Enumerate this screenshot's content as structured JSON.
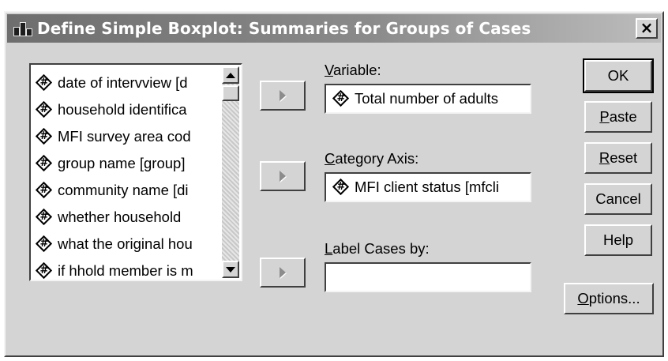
{
  "window": {
    "title": "Define Simple Boxplot: Summaries for Groups of Cases",
    "close_label": "×"
  },
  "variable_list": {
    "items": [
      {
        "label": "date of intervview [d",
        "icon": "numeric-variable-icon"
      },
      {
        "label": "household identifica",
        "icon": "numeric-variable-icon"
      },
      {
        "label": "MFI survey area cod",
        "icon": "numeric-variable-icon"
      },
      {
        "label": "group name [group]",
        "icon": "numeric-variable-icon"
      },
      {
        "label": "community name [di",
        "icon": "numeric-variable-icon"
      },
      {
        "label": "whether household",
        "icon": "numeric-variable-icon"
      },
      {
        "label": "what the original hou",
        "icon": "numeric-variable-icon"
      },
      {
        "label": "if hhold member is m",
        "icon": "numeric-variable-icon"
      }
    ]
  },
  "fields": {
    "variable": {
      "label_mnemonic": "V",
      "label_rest": "ariable:",
      "value": "Total number of adults"
    },
    "category_axis": {
      "label_mnemonic": "C",
      "label_rest": "ategory Axis:",
      "value": "MFI client status [mfcli"
    },
    "label_cases": {
      "label_mnemonic": "L",
      "label_rest": "abel Cases by:",
      "value": ""
    }
  },
  "buttons": {
    "ok": {
      "label": "OK"
    },
    "paste": {
      "mnemonic": "P",
      "rest": "aste"
    },
    "reset": {
      "mnemonic": "R",
      "rest": "eset"
    },
    "cancel": {
      "label": "Cancel"
    },
    "help": {
      "label": "Help"
    },
    "options": {
      "mnemonic": "O",
      "rest": "ptions..."
    }
  },
  "colors": {
    "dialog_face": "#d4d4d4",
    "titlebar_start": "#6e6e6e",
    "titlebar_end": "#bdbdbd"
  }
}
